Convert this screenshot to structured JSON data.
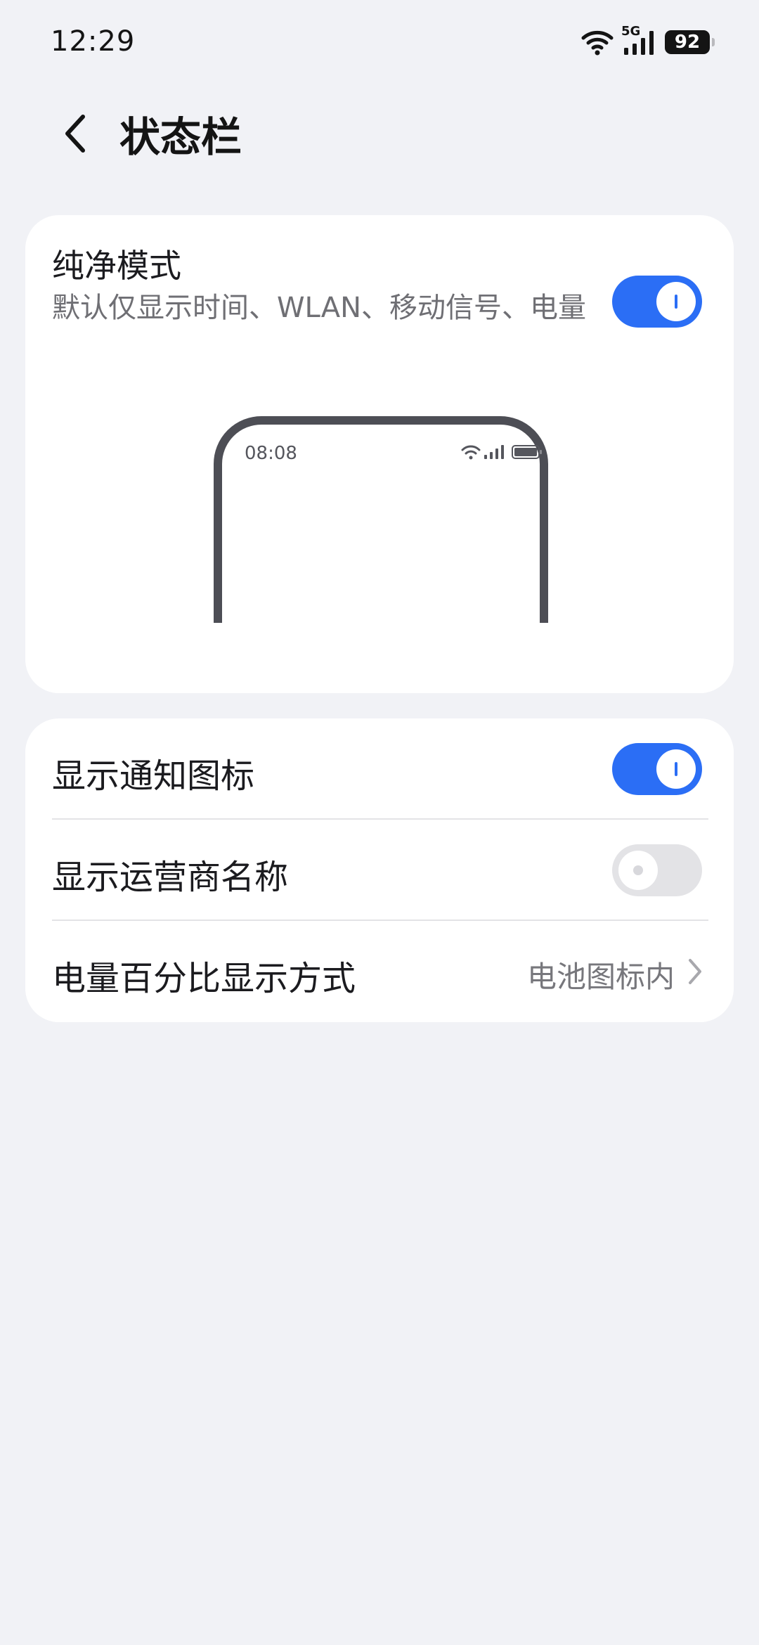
{
  "status_bar": {
    "time": "12:29",
    "network_label": "5G",
    "battery_level": "92",
    "icons": [
      "wifi-icon",
      "signal-icon",
      "battery-icon"
    ]
  },
  "header": {
    "back_icon": "back-arrow-icon",
    "title": "状态栏"
  },
  "pure_mode": {
    "title": "纯净模式",
    "description": "默认仅显示时间、WLAN、移动信号、电量",
    "enabled": true,
    "preview": {
      "time": "08:08",
      "icons": [
        "wifi-icon",
        "signal-icon",
        "battery-icon"
      ]
    }
  },
  "settings": {
    "show_notification_icons": {
      "label": "显示通知图标",
      "enabled": true
    },
    "show_carrier_name": {
      "label": "显示运营商名称",
      "enabled": false
    },
    "battery_percentage": {
      "label": "电量百分比显示方式",
      "value": "电池图标内"
    }
  },
  "colors": {
    "accent": "#2b6ef5",
    "background": "#f1f2f6",
    "card": "#ffffff"
  }
}
